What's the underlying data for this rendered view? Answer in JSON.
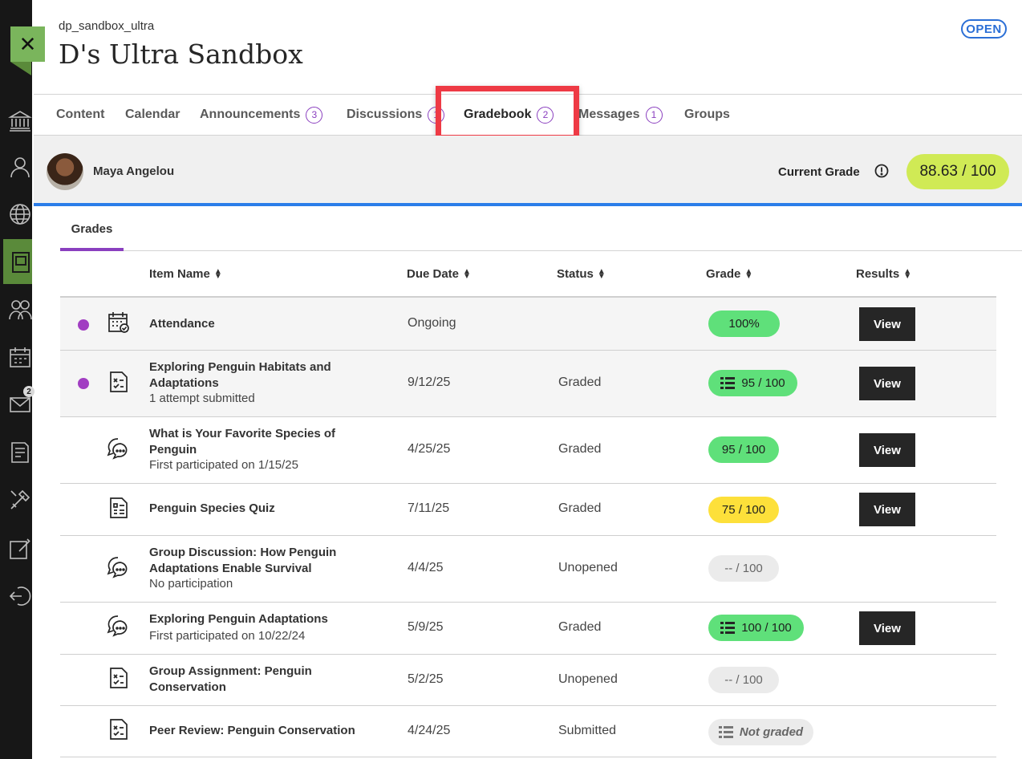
{
  "course": {
    "code": "dp_sandbox_ultra",
    "title": "D's Ultra Sandbox",
    "status": "OPEN"
  },
  "nav_rail": {
    "icons": [
      "institution-icon",
      "profile-icon",
      "globe-icon",
      "courses-icon",
      "groups-icon",
      "calendar-icon",
      "messages-icon",
      "grades-icon",
      "tools-icon",
      "edit-icon",
      "sign-out-icon"
    ],
    "messages_badge": "2"
  },
  "tabs": [
    {
      "label": "Content",
      "count": ""
    },
    {
      "label": "Calendar",
      "count": ""
    },
    {
      "label": "Announcements",
      "count": "3"
    },
    {
      "label": "Discussions",
      "count": "1"
    },
    {
      "label": "Gradebook",
      "count": "2"
    },
    {
      "label": "Messages",
      "count": "1"
    },
    {
      "label": "Groups",
      "count": ""
    }
  ],
  "student": {
    "name": "Maya Angelou",
    "current_grade_label": "Current Grade",
    "current_grade": "88.63 / 100"
  },
  "subtabs": {
    "grades": "Grades"
  },
  "table": {
    "headers": {
      "item_name": "Item Name",
      "due_date": "Due Date",
      "status": "Status",
      "grade": "Grade",
      "results": "Results"
    },
    "view_label": "View",
    "rows": [
      {
        "icon": "attendance-icon",
        "name": "Attendance",
        "sub": "",
        "due": "Ongoing",
        "status": "",
        "grade": "100%",
        "grade_color": "#5fe07a",
        "view": true,
        "new": true
      },
      {
        "icon": "assignment-icon",
        "name": "Exploring Penguin Habitats and Adaptations",
        "sub": "1 attempt submitted",
        "due": "9/12/25",
        "status": "Graded",
        "grade": "95 / 100",
        "grade_color": "#5fe07a",
        "view": true,
        "new": true
      },
      {
        "icon": "discussion-icon",
        "name": "What is Your Favorite Species of Penguin",
        "sub": "First participated on 1/15/25",
        "due": "4/25/25",
        "status": "Graded",
        "grade": "95 / 100",
        "grade_color": "#5fe07a",
        "view": true,
        "new": false
      },
      {
        "icon": "test-icon",
        "name": "Penguin Species Quiz",
        "sub": "",
        "due": "7/11/25",
        "status": "Graded",
        "grade": "75 / 100",
        "grade_color": "#fde03a",
        "view": true,
        "new": false
      },
      {
        "icon": "discussion-icon",
        "name": "Group Discussion: How Penguin Adaptations Enable Survival",
        "sub": "No participation",
        "due": "4/4/25",
        "status": "Unopened",
        "grade": "-- / 100",
        "grade_color": "#ebebeb",
        "view": false,
        "new": false
      },
      {
        "icon": "discussion-icon",
        "name": "Exploring Penguin Adaptations",
        "sub": "First participated on 10/22/24",
        "due": "5/9/25",
        "status": "Graded",
        "grade": "100 / 100",
        "grade_color": "#5fe07a",
        "view": true,
        "new": false
      },
      {
        "icon": "assignment-icon",
        "name": "Group Assignment: Penguin Conservation",
        "sub": "",
        "due": "5/2/25",
        "status": "Unopened",
        "grade": "-- / 100",
        "grade_color": "#ebebeb",
        "view": false,
        "new": false
      },
      {
        "icon": "assignment-icon",
        "name": "Peer Review: Penguin Conservation",
        "sub": "",
        "due": "4/24/25",
        "status": "Submitted",
        "grade": "Not graded",
        "grade_color": "#ebebeb",
        "view": false,
        "new": false
      }
    ]
  },
  "colors": {
    "accent_purple": "#8a3fbf",
    "current_grade_bg": "#d0ea55",
    "highlight_red": "#ee3a45",
    "focus_blue": "#2b7de9"
  }
}
